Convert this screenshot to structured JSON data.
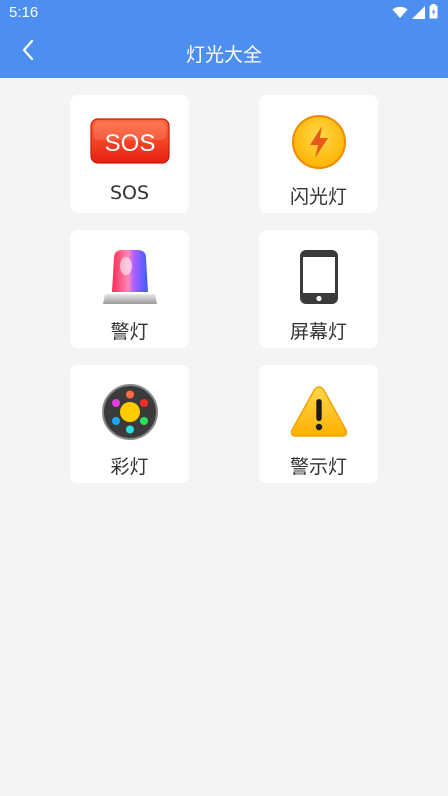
{
  "status_bar": {
    "time": "5:16"
  },
  "header": {
    "title": "灯光大全"
  },
  "sos_badge_text": "SOS",
  "cards": [
    {
      "label": "SOS",
      "icon": "sos-icon"
    },
    {
      "label": "闪光灯",
      "icon": "flash-icon"
    },
    {
      "label": "警灯",
      "icon": "siren-icon"
    },
    {
      "label": "屏幕灯",
      "icon": "phone-icon"
    },
    {
      "label": "彩灯",
      "icon": "color-light-icon"
    },
    {
      "label": "警示灯",
      "icon": "warning-icon"
    }
  ],
  "colors": {
    "header": "#4d8ff0",
    "background": "#f4f4f4",
    "card": "#ffffff"
  }
}
